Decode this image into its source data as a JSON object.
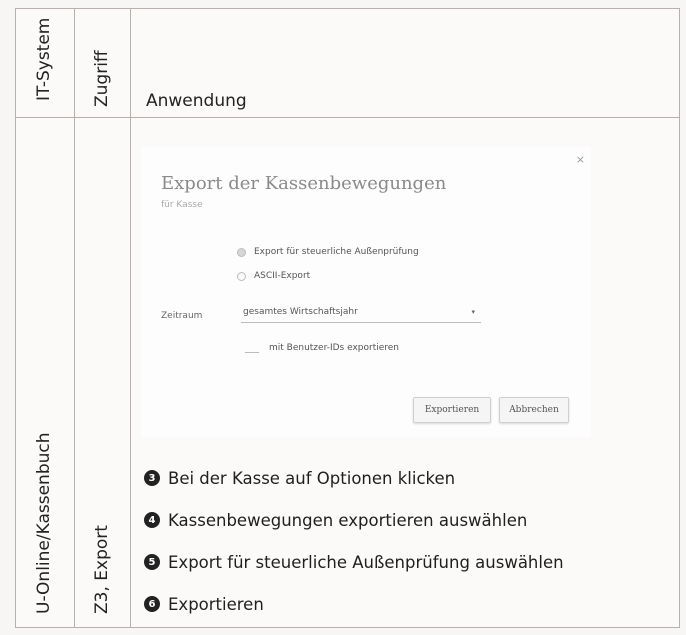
{
  "table": {
    "col1_header": "IT-System",
    "col2_header": "Zugriff",
    "col3_header": "Anwendung",
    "col1_value": "U-Online/Kassenbuch",
    "col2_value": "Z3, Export"
  },
  "dialog": {
    "close": "×",
    "title": "Export der Kassenbewegungen",
    "subtitle": "für Kasse",
    "radio1": "Export für steuerliche Außenprüfung",
    "radio2": "ASCII-Export",
    "zeitraum_label": "Zeitraum",
    "zeitraum_value": "gesamtes Wirtschaftsjahr",
    "select_arrow": "▾",
    "checkbox_label": "mit Benutzer-IDs exportieren",
    "export_button": "Exportieren",
    "cancel_button": "Abbrechen"
  },
  "steps": [
    {
      "num": "3",
      "text": "Bei der Kasse auf Optionen klicken"
    },
    {
      "num": "4",
      "text": "Kassenbewegungen exportieren auswählen"
    },
    {
      "num": "5",
      "text": "Export für steuerliche Außenprüfung auswählen"
    },
    {
      "num": "6",
      "text": "Exportieren"
    }
  ]
}
